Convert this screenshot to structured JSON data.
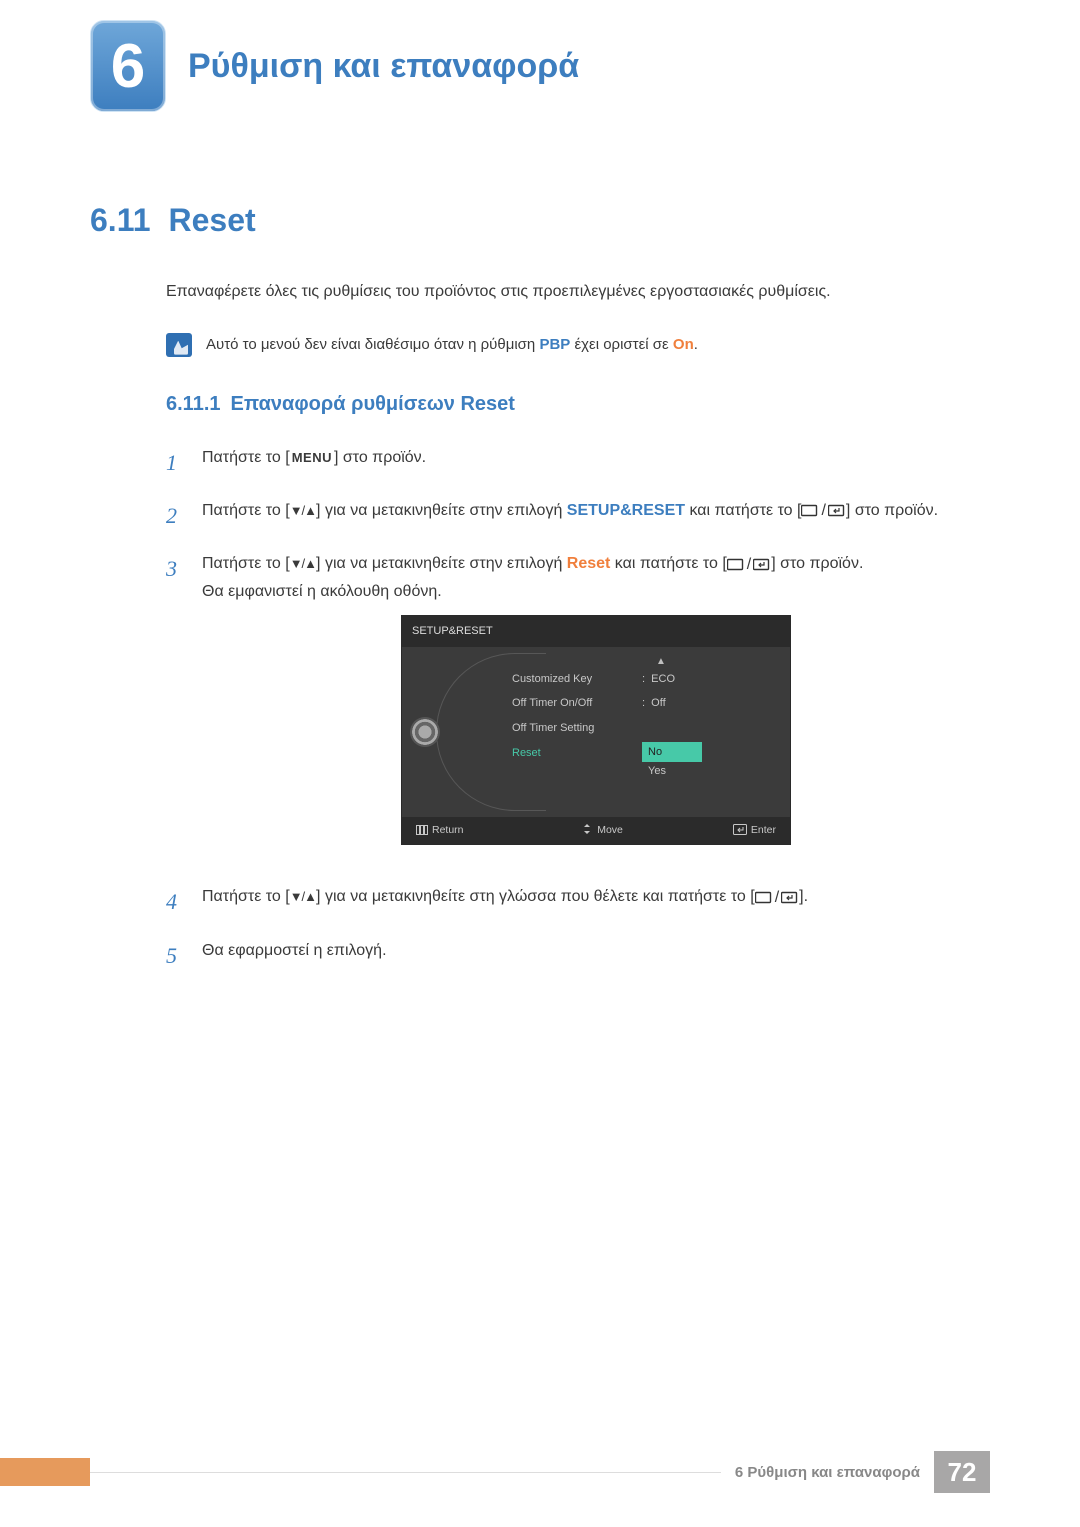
{
  "chapter": {
    "number": "6",
    "title": "Ρύθμιση και επαναφορά"
  },
  "section": {
    "number": "6.11",
    "title": "Reset"
  },
  "intro": "Επαναφέρετε όλες τις ρυθμίσεις του προϊόντος στις προεπιλεγμένες εργοστασιακές ρυθμίσεις.",
  "note": {
    "prefix": "Αυτό το μενού δεν είναι διαθέσιμο όταν η ρύθμιση ",
    "pbp": "PBP",
    "mid": " έχει οριστεί σε ",
    "on": "On",
    "suffix": "."
  },
  "subsection": {
    "number": "6.11.1",
    "title": "Επαναφορά ρυθμίσεων Reset"
  },
  "steps": {
    "s1": {
      "num": "1",
      "a": "Πατήστε το [",
      "menu": "MENU",
      "b": "] στο προϊόν."
    },
    "s2": {
      "num": "2",
      "a": "Πατήστε το [",
      "arrows": "▼/▲",
      "b": "] για να μετακινηθείτε στην επιλογή ",
      "target": "SETUP&RESET",
      "c": " και πατήστε το [",
      "d": "] στο προϊόν."
    },
    "s3": {
      "num": "3",
      "a": "Πατήστε το [",
      "arrows": "▼/▲",
      "b": "] για να μετακινηθείτε στην επιλογή ",
      "target": "Reset",
      "c": " και πατήστε το [",
      "d": "] στο προϊόν.",
      "e": "Θα εμφανιστεί η ακόλουθη οθόνη."
    },
    "s4": {
      "num": "4",
      "a": "Πατήστε το [",
      "arrows": "▼/▲",
      "b": "] για να μετακινηθείτε στη γλώσσα που θέλετε και πατήστε το [",
      "c": "]."
    },
    "s5": {
      "num": "5",
      "a": "Θα εφαρμοστεί η επιλογή."
    }
  },
  "osd": {
    "header": "SETUP&RESET",
    "rows": [
      {
        "label": "Customized Key",
        "value": "ECO"
      },
      {
        "label": "Off Timer On/Off",
        "value": "Off"
      },
      {
        "label": "Off Timer Setting",
        "value": ""
      }
    ],
    "reset_label": "Reset",
    "choice_sel": "No",
    "choice_alt": "Yes",
    "footer": {
      "return": "Return",
      "move": "Move",
      "enter": "Enter"
    }
  },
  "footer": {
    "text": "6 Ρύθμιση και επαναφορά",
    "page": "72"
  }
}
